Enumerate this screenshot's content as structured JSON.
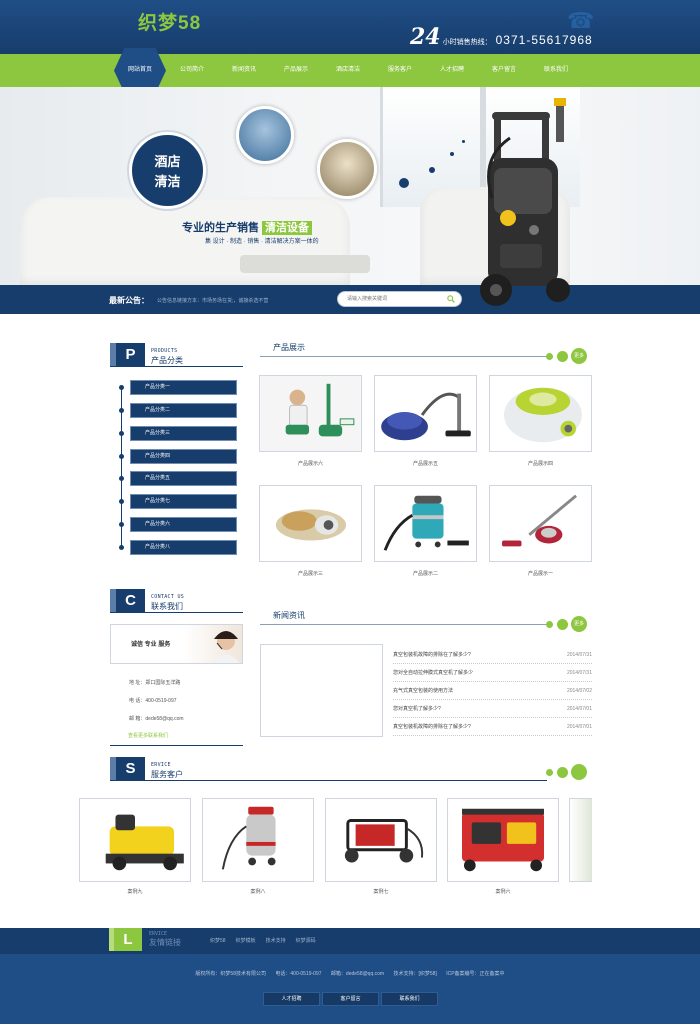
{
  "header": {
    "logo": "织梦58",
    "hotline_24": "24",
    "hotline_label": "小时销售热线：",
    "hotline_number": "0371-55617968"
  },
  "nav": {
    "items": [
      "网站首页",
      "公司简介",
      "新闻资讯",
      "产品展示",
      "酒店清洁",
      "服务客户",
      "人才招聘",
      "客户留言",
      "联系我们"
    ],
    "active_index": 0
  },
  "banner": {
    "badge_line1": "酒店",
    "badge_line2": "清洁",
    "slogan_main": "专业的生产销售",
    "slogan_highlight": "清洁设备",
    "slogan_sub": "集 设计 · 制造 · 销售 · 清洁解决方案一体的"
  },
  "notice": {
    "title": "最新公告：",
    "text": "公告信息链接方本：市场务场在货;，诚接杀选不营",
    "search_placeholder": "请输入搜索关键词"
  },
  "products_section": {
    "letter": "P",
    "en": "PRODUCTS",
    "cn": "产品分类",
    "categories": [
      "产品分类一",
      "产品分类二",
      "产品分类三",
      "产品分类四",
      "产品分类五",
      "产品分类七",
      "产品分类六",
      "产品分类八"
    ]
  },
  "product_show": {
    "title": "产品展示",
    "more": "更多",
    "items": [
      "产品展示六",
      "产品展示五",
      "产品展示四",
      "产品展示三",
      "产品展示二",
      "产品展示一"
    ]
  },
  "contact_section": {
    "letter": "C",
    "en": "CONTACT US",
    "cn": "联系我们",
    "slogan": "诚信  专业  服务",
    "address": "地     址：郑口国际五洋路",
    "phone": "电     话：400-0519-097",
    "email": "邮     箱：dede58@qq.com",
    "more": "查看更多联系我们"
  },
  "news_section": {
    "title": "新闻资讯",
    "more": "更多",
    "items": [
      {
        "title": "真空包装机故障的排除在了解多少?",
        "date": "2014/07/31"
      },
      {
        "title": "您对全自动拉伸膜式真空机了解多少",
        "date": "2014/07/31"
      },
      {
        "title": "充气式真空包装的使用方法",
        "date": "2014/07/02"
      },
      {
        "title": "您对真空机了解多少?",
        "date": "2014/07/01"
      },
      {
        "title": "真空包装机故障的排除在了解多少?",
        "date": "2014/07/01"
      }
    ]
  },
  "service_section": {
    "letter": "S",
    "en": "ERVICE",
    "cn": "服务客户",
    "items": [
      "案例九",
      "案例八",
      "案例七",
      "案例六"
    ]
  },
  "links_section": {
    "letter": "L",
    "en": "ERVICE",
    "cn": "友情链接",
    "items": [
      "织梦58",
      "织梦模板",
      "技术支持",
      "织梦源码"
    ]
  },
  "footer": {
    "copyright": "版权所有：织梦58技术有限公司",
    "phone": "电话：400-0519-097",
    "email": "邮箱：dede58@qq.com",
    "support": "技术支持：[织梦58]",
    "icp": "ICP备案编号：正在备案中",
    "buttons": [
      "人才招聘",
      "客户留言",
      "联系我们"
    ]
  },
  "colors": {
    "navy": "#173d6c",
    "blue": "#1f4e86",
    "green": "#8dc63f"
  }
}
